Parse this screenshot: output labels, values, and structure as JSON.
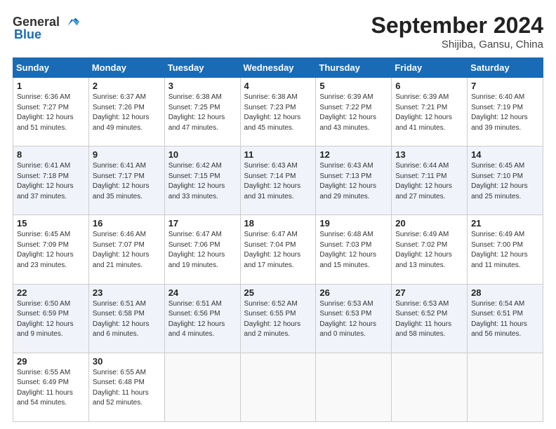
{
  "header": {
    "logo_general": "General",
    "logo_blue": "Blue",
    "month_title": "September 2024",
    "subtitle": "Shijiba, Gansu, China"
  },
  "columns": [
    "Sunday",
    "Monday",
    "Tuesday",
    "Wednesday",
    "Thursday",
    "Friday",
    "Saturday"
  ],
  "rows": [
    [
      {
        "day": "1",
        "lines": [
          "Sunrise: 6:36 AM",
          "Sunset: 7:27 PM",
          "Daylight: 12 hours",
          "and 51 minutes."
        ]
      },
      {
        "day": "2",
        "lines": [
          "Sunrise: 6:37 AM",
          "Sunset: 7:26 PM",
          "Daylight: 12 hours",
          "and 49 minutes."
        ]
      },
      {
        "day": "3",
        "lines": [
          "Sunrise: 6:38 AM",
          "Sunset: 7:25 PM",
          "Daylight: 12 hours",
          "and 47 minutes."
        ]
      },
      {
        "day": "4",
        "lines": [
          "Sunrise: 6:38 AM",
          "Sunset: 7:23 PM",
          "Daylight: 12 hours",
          "and 45 minutes."
        ]
      },
      {
        "day": "5",
        "lines": [
          "Sunrise: 6:39 AM",
          "Sunset: 7:22 PM",
          "Daylight: 12 hours",
          "and 43 minutes."
        ]
      },
      {
        "day": "6",
        "lines": [
          "Sunrise: 6:39 AM",
          "Sunset: 7:21 PM",
          "Daylight: 12 hours",
          "and 41 minutes."
        ]
      },
      {
        "day": "7",
        "lines": [
          "Sunrise: 6:40 AM",
          "Sunset: 7:19 PM",
          "Daylight: 12 hours",
          "and 39 minutes."
        ]
      }
    ],
    [
      {
        "day": "8",
        "lines": [
          "Sunrise: 6:41 AM",
          "Sunset: 7:18 PM",
          "Daylight: 12 hours",
          "and 37 minutes."
        ]
      },
      {
        "day": "9",
        "lines": [
          "Sunrise: 6:41 AM",
          "Sunset: 7:17 PM",
          "Daylight: 12 hours",
          "and 35 minutes."
        ]
      },
      {
        "day": "10",
        "lines": [
          "Sunrise: 6:42 AM",
          "Sunset: 7:15 PM",
          "Daylight: 12 hours",
          "and 33 minutes."
        ]
      },
      {
        "day": "11",
        "lines": [
          "Sunrise: 6:43 AM",
          "Sunset: 7:14 PM",
          "Daylight: 12 hours",
          "and 31 minutes."
        ]
      },
      {
        "day": "12",
        "lines": [
          "Sunrise: 6:43 AM",
          "Sunset: 7:13 PM",
          "Daylight: 12 hours",
          "and 29 minutes."
        ]
      },
      {
        "day": "13",
        "lines": [
          "Sunrise: 6:44 AM",
          "Sunset: 7:11 PM",
          "Daylight: 12 hours",
          "and 27 minutes."
        ]
      },
      {
        "day": "14",
        "lines": [
          "Sunrise: 6:45 AM",
          "Sunset: 7:10 PM",
          "Daylight: 12 hours",
          "and 25 minutes."
        ]
      }
    ],
    [
      {
        "day": "15",
        "lines": [
          "Sunrise: 6:45 AM",
          "Sunset: 7:09 PM",
          "Daylight: 12 hours",
          "and 23 minutes."
        ]
      },
      {
        "day": "16",
        "lines": [
          "Sunrise: 6:46 AM",
          "Sunset: 7:07 PM",
          "Daylight: 12 hours",
          "and 21 minutes."
        ]
      },
      {
        "day": "17",
        "lines": [
          "Sunrise: 6:47 AM",
          "Sunset: 7:06 PM",
          "Daylight: 12 hours",
          "and 19 minutes."
        ]
      },
      {
        "day": "18",
        "lines": [
          "Sunrise: 6:47 AM",
          "Sunset: 7:04 PM",
          "Daylight: 12 hours",
          "and 17 minutes."
        ]
      },
      {
        "day": "19",
        "lines": [
          "Sunrise: 6:48 AM",
          "Sunset: 7:03 PM",
          "Daylight: 12 hours",
          "and 15 minutes."
        ]
      },
      {
        "day": "20",
        "lines": [
          "Sunrise: 6:49 AM",
          "Sunset: 7:02 PM",
          "Daylight: 12 hours",
          "and 13 minutes."
        ]
      },
      {
        "day": "21",
        "lines": [
          "Sunrise: 6:49 AM",
          "Sunset: 7:00 PM",
          "Daylight: 12 hours",
          "and 11 minutes."
        ]
      }
    ],
    [
      {
        "day": "22",
        "lines": [
          "Sunrise: 6:50 AM",
          "Sunset: 6:59 PM",
          "Daylight: 12 hours",
          "and 9 minutes."
        ]
      },
      {
        "day": "23",
        "lines": [
          "Sunrise: 6:51 AM",
          "Sunset: 6:58 PM",
          "Daylight: 12 hours",
          "and 6 minutes."
        ]
      },
      {
        "day": "24",
        "lines": [
          "Sunrise: 6:51 AM",
          "Sunset: 6:56 PM",
          "Daylight: 12 hours",
          "and 4 minutes."
        ]
      },
      {
        "day": "25",
        "lines": [
          "Sunrise: 6:52 AM",
          "Sunset: 6:55 PM",
          "Daylight: 12 hours",
          "and 2 minutes."
        ]
      },
      {
        "day": "26",
        "lines": [
          "Sunrise: 6:53 AM",
          "Sunset: 6:53 PM",
          "Daylight: 12 hours",
          "and 0 minutes."
        ]
      },
      {
        "day": "27",
        "lines": [
          "Sunrise: 6:53 AM",
          "Sunset: 6:52 PM",
          "Daylight: 11 hours",
          "and 58 minutes."
        ]
      },
      {
        "day": "28",
        "lines": [
          "Sunrise: 6:54 AM",
          "Sunset: 6:51 PM",
          "Daylight: 11 hours",
          "and 56 minutes."
        ]
      }
    ],
    [
      {
        "day": "29",
        "lines": [
          "Sunrise: 6:55 AM",
          "Sunset: 6:49 PM",
          "Daylight: 11 hours",
          "and 54 minutes."
        ]
      },
      {
        "day": "30",
        "lines": [
          "Sunrise: 6:55 AM",
          "Sunset: 6:48 PM",
          "Daylight: 11 hours",
          "and 52 minutes."
        ]
      },
      null,
      null,
      null,
      null,
      null
    ]
  ]
}
